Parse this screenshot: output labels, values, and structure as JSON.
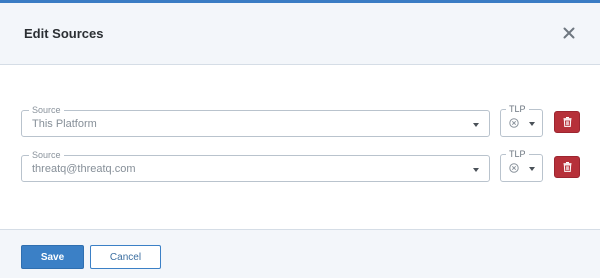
{
  "modal": {
    "title": "Edit Sources"
  },
  "sources": [
    {
      "label": "Source",
      "value": "This Platform",
      "tlp_label": "TLP"
    },
    {
      "label": "Source",
      "value": "threatq@threatq.com",
      "tlp_label": "TLP"
    }
  ],
  "footer": {
    "save_label": "Save",
    "cancel_label": "Cancel"
  },
  "colors": {
    "accent": "#3b80c6",
    "danger": "#b63039",
    "header_bg": "#f3f6fa"
  },
  "icons": {
    "close": "close-icon",
    "clear": "clear-circle-icon",
    "delete": "trash-icon",
    "dropdown": "chevron-down-icon"
  }
}
